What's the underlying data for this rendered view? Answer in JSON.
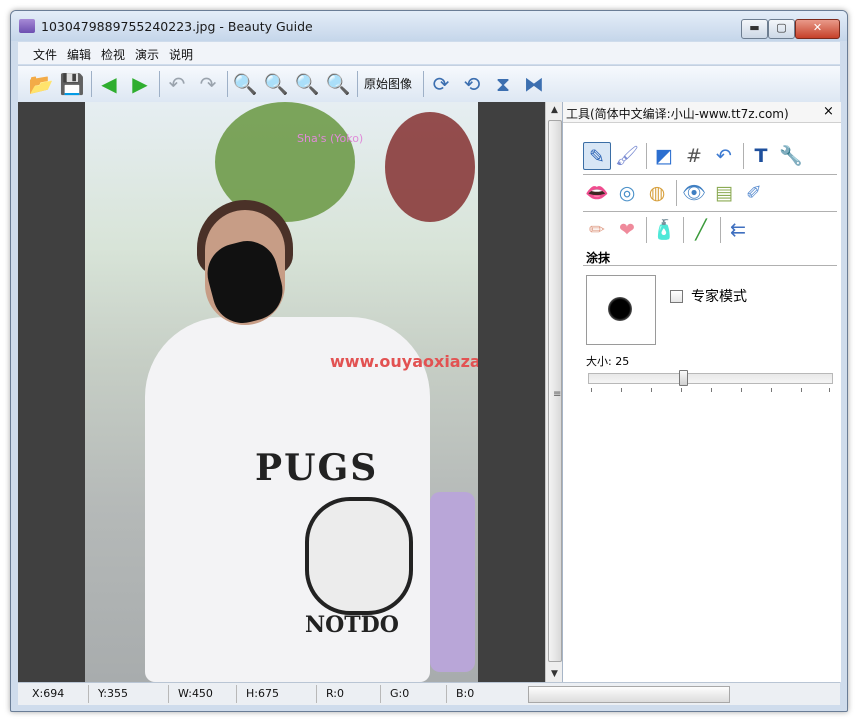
{
  "window": {
    "title": "1030479889755240223.jpg - Beauty Guide"
  },
  "menu": [
    "文件",
    "编辑",
    "检视",
    "演示",
    "说明"
  ],
  "toolbar": {
    "open_icon": "folder-open-icon",
    "save_icon": "save-disk-icon",
    "back_icon": "arrow-left-icon",
    "forward_icon": "arrow-right-icon",
    "undo_icon": "undo-icon",
    "redo_icon": "redo-icon",
    "zoom_in_icon": "zoom-in-icon",
    "zoom_out_icon": "zoom-out-icon",
    "zoom_fit_icon": "zoom-fit-icon",
    "zoom_actual_icon": "zoom-actual-icon",
    "original_label": "原始图像",
    "rotate_cw_icon": "rotate-clockwise-icon",
    "rotate_ccw_icon": "rotate-counterclockwise-icon",
    "flip_v_icon": "flip-vertical-icon",
    "flip_h_icon": "flip-horizontal-icon"
  },
  "image": {
    "watermark_top": "Sha's (Yoko)",
    "shirt_text": "PUGS",
    "shirt_text_bottom": "NOTDO",
    "watermark": "www.ouyaoxiazai.com"
  },
  "panel": {
    "title": "工具(简体中文编译:小山-www.tt7z.com)",
    "close": "×",
    "section": "涂抹",
    "expert_mode": "专家模式",
    "size_label": "大小: 25",
    "size_value": 25
  },
  "status": {
    "x": "X:694",
    "y": "Y:355",
    "w": "W:450",
    "h": "H:675",
    "r": "R:0",
    "g": "G:0",
    "b": "B:0"
  },
  "colors": {
    "title_bg": "#c5d6ea",
    "canvas_bg": "#404040",
    "watermark": "#e25252"
  }
}
